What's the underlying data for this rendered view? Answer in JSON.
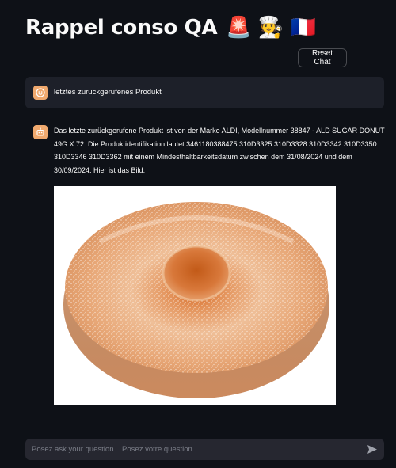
{
  "header": {
    "title": "Rappel conso QA",
    "title_emojis": "🚨 🧑‍🍳 🇫🇷"
  },
  "toolbar": {
    "reset_label": "Reset Chat"
  },
  "chat": {
    "user_message": "letztes zuruckgerufenes Produkt",
    "assistant_message": "Das letzte zurückgerufene Produkt ist von der Marke ALDI, Modellnummer 38847 - ALD SUGAR DONUT 49G X 72. Die Produktidentifikation lautet 3461180388475 310D3325 310D3328 310D3342 310D3350 310D3346 310D3362 mit einem Mindesthaltbarkeitsdatum zwischen dem 31/08/2024 und dem 30/09/2024. Hier ist das Bild:",
    "image_subject": "sugar donut"
  },
  "input": {
    "placeholder": "Posez ask your question... Posez votre question",
    "value": ""
  },
  "icons": {
    "user_avatar": "user-avatar-icon",
    "assistant_avatar": "assistant-avatar-icon",
    "send": "send-icon"
  },
  "colors": {
    "background": "#0e1117",
    "user_bubble": "#1d2029",
    "input_bg": "#262730",
    "avatar": "#f0a96e",
    "text": "#fafafa"
  }
}
